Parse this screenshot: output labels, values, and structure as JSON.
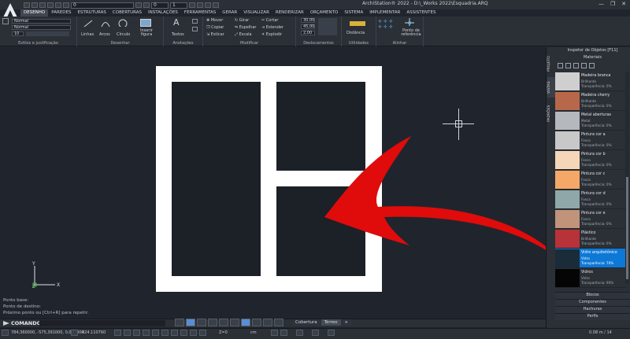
{
  "app": {
    "title": "ArchiStation® 2022 - D:\\_Works 2022\\Esquadria.ARQ",
    "window_controls": [
      "—",
      "❐",
      "✕"
    ]
  },
  "quick_access": {
    "layer_value": "0",
    "layer_value2": "0",
    "linetype_value": "1"
  },
  "menu": {
    "tabs": [
      {
        "label": "DESENHO",
        "active": true
      },
      {
        "label": "PAREDES",
        "active": false
      },
      {
        "label": "ESTRUTURAS",
        "active": false
      },
      {
        "label": "COBERTURAS",
        "active": false
      },
      {
        "label": "INSTALAÇÕES",
        "active": false
      },
      {
        "label": "FERRAMENTAS",
        "active": false
      },
      {
        "label": "GERAR",
        "active": false
      },
      {
        "label": "VISUALIZAR",
        "active": false
      },
      {
        "label": "RENDERIZAR",
        "active": false
      },
      {
        "label": "ORÇAMENTO",
        "active": false
      },
      {
        "label": "SISTEMA",
        "active": false
      },
      {
        "label": "IMPLEMENTAR",
        "active": false
      },
      {
        "label": "ASSISTENTES",
        "active": false
      }
    ]
  },
  "ribbon": {
    "style_normal_1": "Normal",
    "style_normal_2": "Normal",
    "style_value": "10",
    "groups": {
      "estilos": "Estilos e justificação",
      "desenhar": "Desenhar",
      "anotacoes": "Anotações",
      "modificar": "Modificar",
      "deslocamentos": "Deslocamentos",
      "utilidades": "Utilidades",
      "alinhar": "Alinhar"
    },
    "desenhar_tools": {
      "linhas": "Linhas",
      "arcos": "Arcos",
      "circulos": "Círculo",
      "inserir": "Inserir figura"
    },
    "anotacoes_tools": {
      "textos": "Textos"
    },
    "modificar_tools": {
      "mover": "Mover",
      "copiar": "Copiar",
      "esticar": "Esticar",
      "girar": "Girar",
      "espelhar": "Espelhar",
      "escala": "Escala",
      "cortar": "Cortar",
      "estender": "Estender",
      "explodir": "Explodir"
    },
    "deslocamentos_inputs": [
      "30,00",
      "45,00",
      "2,00"
    ],
    "utilidades_tools": {
      "distancia": "Distância"
    },
    "alinhar_tools": {
      "ponto_ref": "Ponto de referência"
    }
  },
  "command": {
    "history": [
      "Ponto base:",
      "Ponto de destino:",
      "Próximo ponto ou [Ctrl+R] para repetir:"
    ],
    "label": "COMANDO:"
  },
  "layout_tabs": [
    {
      "label": "Cobertura",
      "active": false
    },
    {
      "label": "Térreo",
      "active": true
    },
    {
      "label": "+",
      "active": false
    }
  ],
  "status": {
    "coords": "784,360000, -575,391000, 0,000000",
    "scale_value": "424.110760",
    "z_value": "Z=0",
    "units": "cm",
    "zoom": "0.08 m / 14"
  },
  "side_tabs": [
    "PROJETO",
    "VISTAS",
    "PADRÕES"
  ],
  "panel": {
    "title": "Inspetor de Objetos [F11]",
    "subtitle": "Materiais",
    "materials": [
      {
        "name": "Madeira branca",
        "type": "Brilhante",
        "trans": "Transparência: 0%",
        "color": "#cfcfcf",
        "selected": false
      },
      {
        "name": "Madeira cherry",
        "type": "Brilhante",
        "trans": "Transparência: 0%",
        "color": "#b8684a",
        "selected": false
      },
      {
        "name": "Metal aberturas",
        "type": "Metal",
        "trans": "Transparência: 0%",
        "color": "#b5b8bd",
        "selected": false
      },
      {
        "name": "Pintura cor a",
        "type": "Fosca",
        "trans": "Transparência: 0%",
        "color": "#c8c8c8",
        "selected": false
      },
      {
        "name": "Pintura cor b",
        "type": "Fosca",
        "trans": "Transparência: 0%",
        "color": "#f6d6b8",
        "selected": false
      },
      {
        "name": "Pintura cor c",
        "type": "Fosca",
        "trans": "Transparência: 0%",
        "color": "#f4a868",
        "selected": false
      },
      {
        "name": "Pintura cor d",
        "type": "Fosca",
        "trans": "Transparência: 0%",
        "color": "#8fa7a8",
        "selected": false
      },
      {
        "name": "Pintura cor e",
        "type": "Fosca",
        "trans": "Transparência: 0%",
        "color": "#c0937a",
        "selected": false
      },
      {
        "name": "Plástico",
        "type": "Brilhante",
        "trans": "Transparência: 0%",
        "color": "#b8323a",
        "selected": false
      },
      {
        "name": "Vidro arquitetônico",
        "type": "Vidro",
        "trans": "Transparência: 70%",
        "color": "#1a2b3a",
        "selected": true
      },
      {
        "name": "Vidros",
        "type": "Vidro",
        "trans": "Transparência: 90%",
        "color": "#050505",
        "selected": false
      }
    ],
    "sections": [
      "Blocos",
      "Componentes",
      "Hachuras",
      "Perfis"
    ]
  },
  "colors": {
    "arrow": "#e00b0b",
    "accent": "#0d78d6",
    "canvas": "#20252d",
    "frame": "#ffffff",
    "glass": "#1c2027"
  }
}
